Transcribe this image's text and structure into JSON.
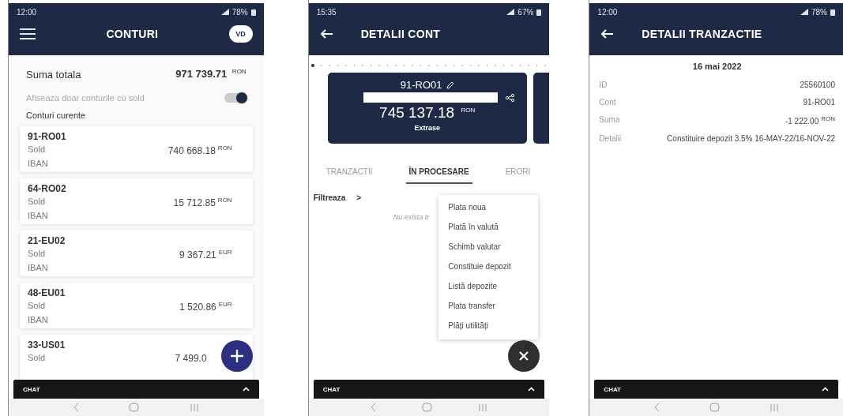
{
  "accounts_screen": {
    "status": {
      "time": "12:00",
      "battery": "78%"
    },
    "title": "CONTURI",
    "avatar": "VD",
    "total": {
      "label": "Suma totala",
      "amount": "971 739.71",
      "currency": "RON"
    },
    "toggle": {
      "label": "Afiseaza doar conturile cu sold",
      "on": true
    },
    "section": "Conturi curente",
    "accounts": [
      {
        "name": "91-RO01",
        "sold_label": "Sold",
        "amount": "740 668.18",
        "currency": "RON",
        "iban_label": "IBAN"
      },
      {
        "name": "64-RO02",
        "sold_label": "Sold",
        "amount": "15 712.85",
        "currency": "RON",
        "iban_label": "IBAN"
      },
      {
        "name": "21-EU02",
        "sold_label": "Sold",
        "amount": "9 367.21",
        "currency": "EUR",
        "iban_label": "IBAN"
      },
      {
        "name": "48-EU01",
        "sold_label": "Sold",
        "amount": "1 520.86",
        "currency": "EUR",
        "iban_label": "IBAN"
      },
      {
        "name": "33-US01",
        "sold_label": "Sold",
        "amount": "7 499.0"
      }
    ],
    "chat": "CHAT"
  },
  "account_details_screen": {
    "status": {
      "time": "15:35",
      "battery": "67%"
    },
    "title": "DETALII CONT",
    "card": {
      "name": "91-RO01",
      "amount": "745 137.18",
      "currency": "RON",
      "action": "Extrase"
    },
    "tabs": [
      {
        "label": "TRANZACTII",
        "selected": false
      },
      {
        "label": "ÎN PROCESARE",
        "selected": true
      },
      {
        "label": "ERORI",
        "selected": false
      }
    ],
    "filter": "Filtreaza",
    "filter_arrow": ">",
    "empty": "Nu exista tr",
    "menu": [
      "Plata noua",
      "Plată în valută",
      "Schimb valutar",
      "Constituie depozit",
      "Listă depozite",
      "Plata transfer",
      "Plăți utilități"
    ],
    "chat": "CHAT"
  },
  "transaction_screen": {
    "status": {
      "time": "12:00",
      "battery": "78%"
    },
    "title": "DETALII TRANZACTIE",
    "date": "16 mai 2022",
    "rows": [
      {
        "label": "ID",
        "value": "25560100"
      },
      {
        "label": "Cont",
        "value": "91-RO01"
      },
      {
        "label": "Suma",
        "value": "-1 222.00",
        "currency": "RON"
      },
      {
        "label": "Detalii",
        "value": "Constituire depozit 3.5% 16-MAY-22/16-NOV-22"
      }
    ],
    "chat": "CHAT"
  }
}
